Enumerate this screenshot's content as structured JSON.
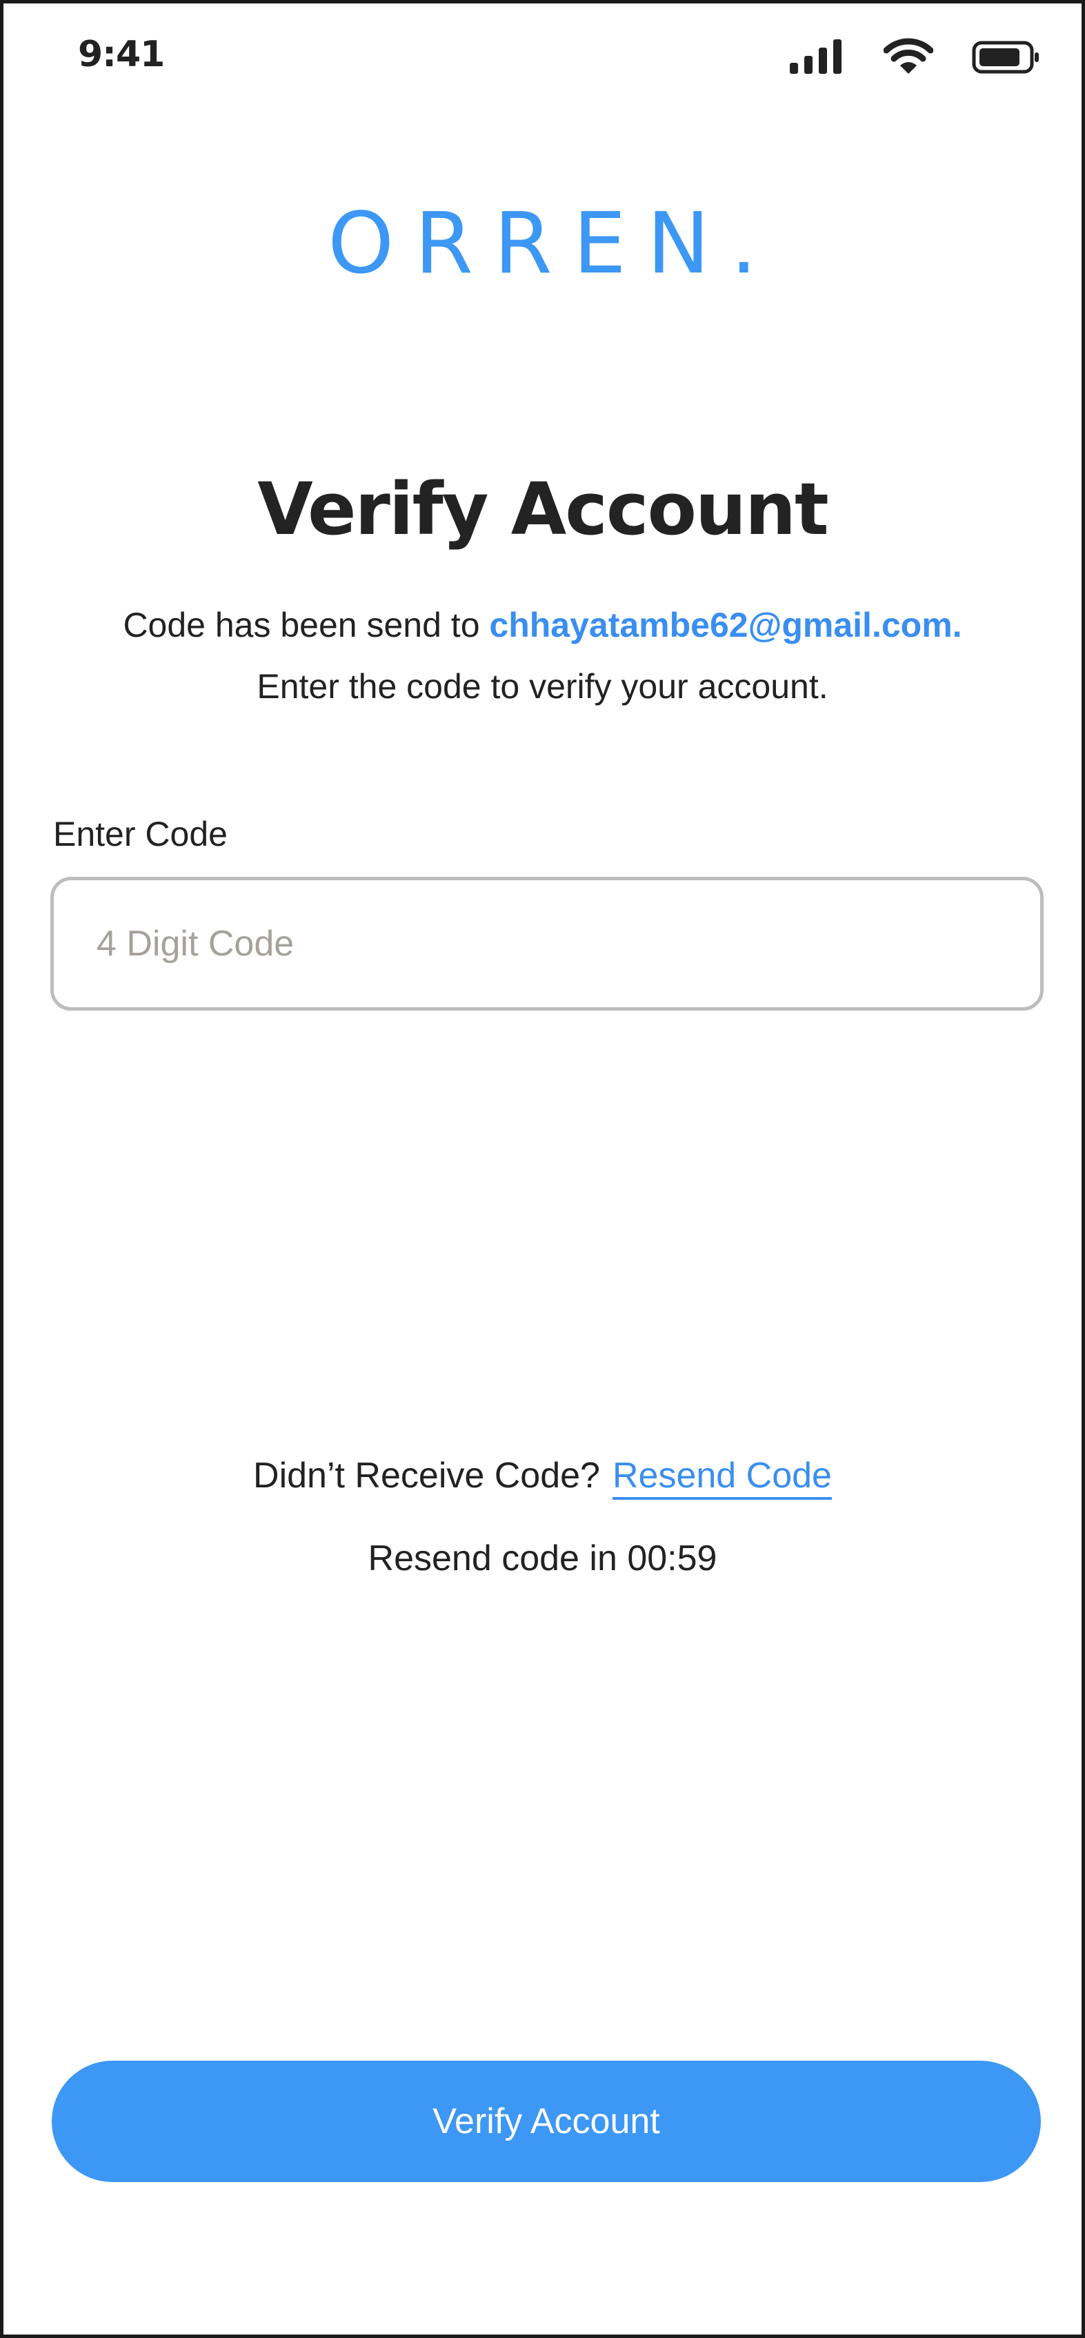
{
  "status_bar": {
    "time": "9:41"
  },
  "icons": {
    "signal": "signal-icon",
    "wifi": "wifi-icon",
    "battery": "battery-icon"
  },
  "logo": {
    "text": "ORREN."
  },
  "page": {
    "title": "Verify Account",
    "description_prefix": "Code has been send to ",
    "email": "chhayatambe62@gmail.com.",
    "description_line2": "Enter the code to verify your account."
  },
  "code_field": {
    "label": "Enter Code",
    "value": "",
    "placeholder": "4 Digit Code"
  },
  "resend": {
    "prompt": "Didn’t Receive Code?",
    "link_label": "Resend Code",
    "timer_text": "Resend code in 00:59"
  },
  "actions": {
    "verify_label": "Verify Account"
  },
  "colors": {
    "accent": "#3d97f4",
    "link": "#3a8ef0",
    "text": "#222222",
    "input_border": "#bdbdbd",
    "placeholder": "#a5a29b"
  }
}
